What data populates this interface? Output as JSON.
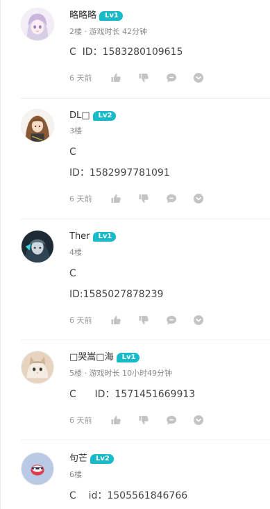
{
  "comments": [
    {
      "username": "略略略",
      "level": "Lv1",
      "floor": "2楼",
      "meta_extra": " · 游戏时长 42分钟",
      "lines": [
        "C  ID：1583280109615"
      ],
      "time": "6 天前",
      "avatar_icon": "anime-girl-avatar"
    },
    {
      "username": "DL□",
      "level": "Lv2",
      "floor": "3楼",
      "meta_extra": "",
      "lines": [
        "C",
        "ID：1582997781091"
      ],
      "time": "6 天前",
      "avatar_icon": "anime-soldier-avatar"
    },
    {
      "username": "Ther",
      "level": "Lv1",
      "floor": "4楼",
      "meta_extra": "",
      "lines": [
        "C",
        "ID:1585027878239"
      ],
      "time": "6 天前",
      "avatar_icon": "dark-robot-avatar"
    },
    {
      "username": "□哭嵩□海",
      "level": "Lv1",
      "floor": "5楼",
      "meta_extra": " · 游戏时长 10小时49分钟",
      "lines": [
        "C      ID：1571451669913"
      ],
      "time": "6 天前",
      "avatar_icon": "cat-avatar"
    },
    {
      "username": "句芒",
      "level": "Lv2",
      "floor": "6楼",
      "meta_extra": "",
      "lines": [
        "C    id：1505561846766"
      ],
      "time": "",
      "avatar_icon": "blue-mascot-avatar"
    }
  ],
  "action_icons": [
    "thumbs-up-icon",
    "thumbs-down-icon",
    "reply-bubble-icon",
    "more-chevron-icon"
  ],
  "colors": {
    "level_badge": "#18b9c9",
    "icon_gray": "#c4c4c4",
    "text_primary": "#333333",
    "text_secondary": "#888888"
  }
}
